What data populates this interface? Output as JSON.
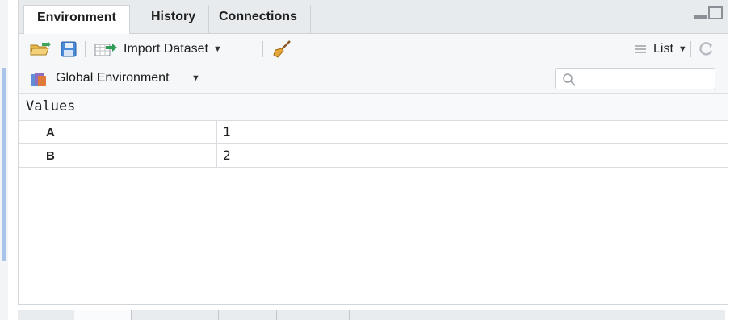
{
  "tabs": [
    {
      "label": "Environment",
      "active": true
    },
    {
      "label": "History",
      "active": false
    },
    {
      "label": "Connections",
      "active": false
    }
  ],
  "toolbar": {
    "open_icon": "open-folder-icon",
    "save_icon": "save-icon",
    "import_label": "Import Dataset",
    "broom_icon": "broom-icon",
    "view_label": "List",
    "refresh_icon": "refresh-icon"
  },
  "environment": {
    "selector_label": "Global Environment",
    "search_placeholder": ""
  },
  "section": {
    "title": "Values"
  },
  "values": [
    {
      "name": "A",
      "value": "1"
    },
    {
      "name": "B",
      "value": "2"
    }
  ],
  "colors": {
    "tabbar_bg": "#e8ebee",
    "toolbar_bg": "#f6f7f8",
    "left_accent": "#a9c4e8"
  }
}
